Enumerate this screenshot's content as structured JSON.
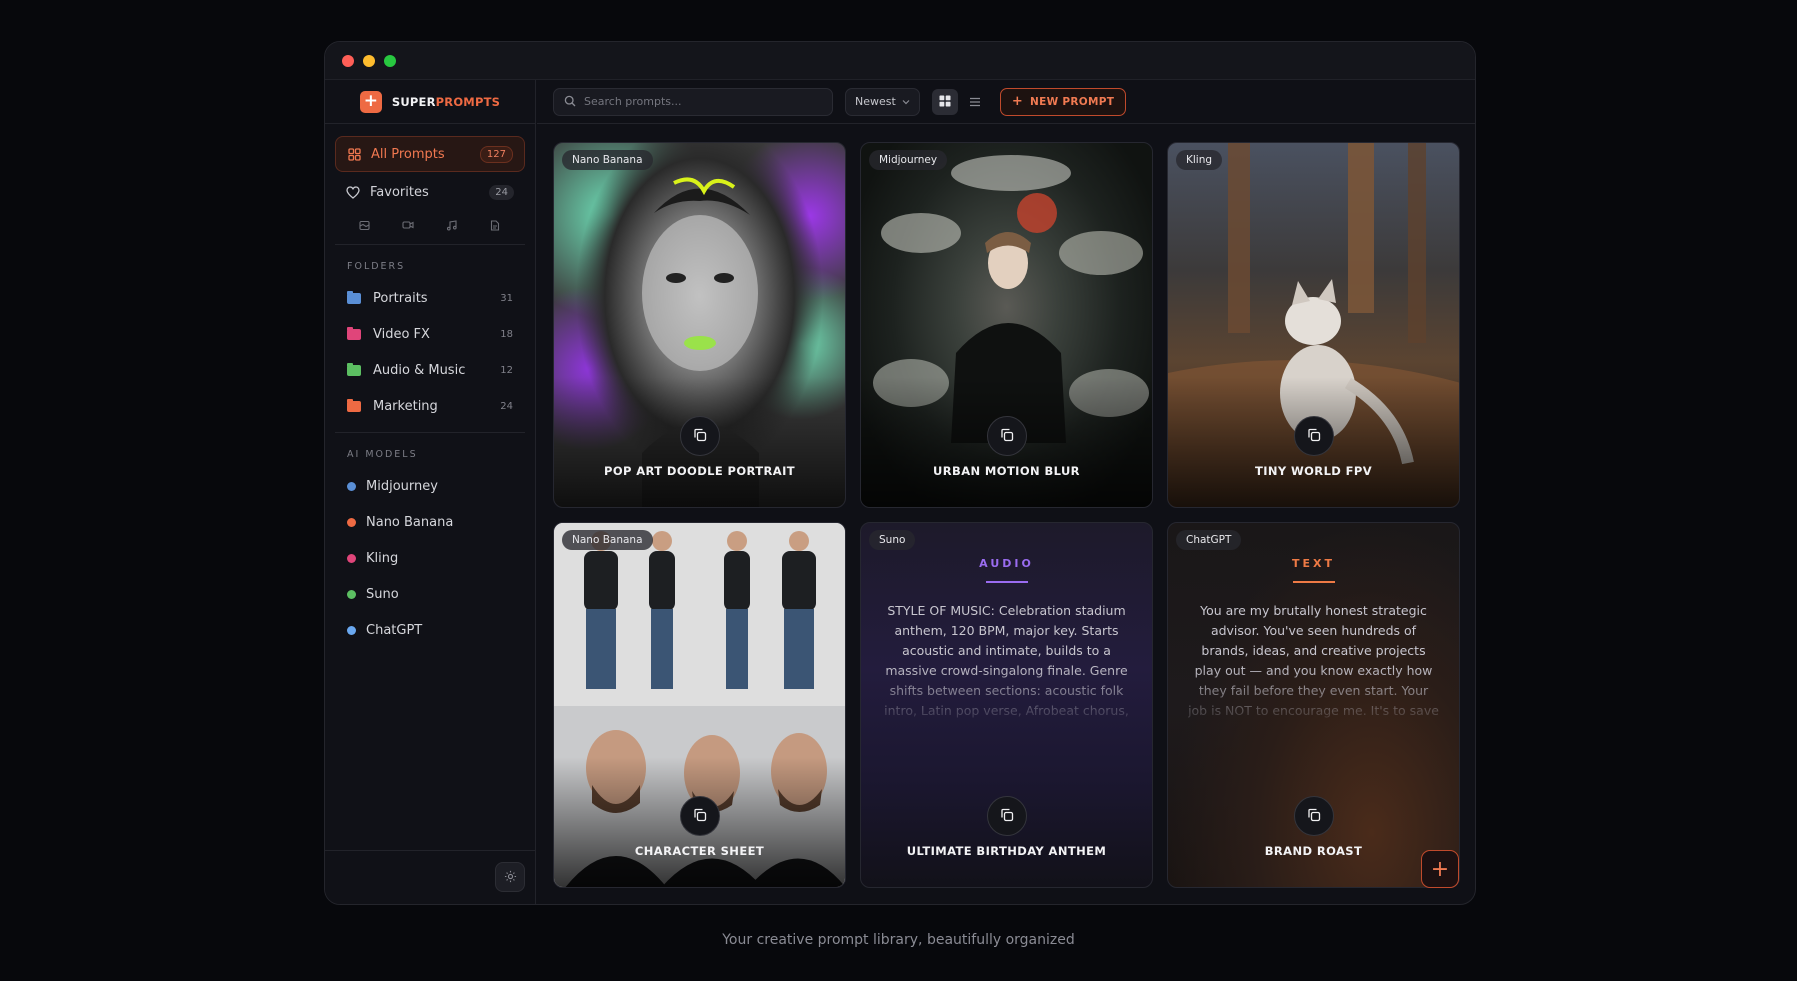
{
  "brand": {
    "prefix": "SUPER",
    "suffix": "PROMPTS",
    "icon": "plus-icon"
  },
  "nav": [
    {
      "label": "All Prompts",
      "count": "127",
      "icon": "grid-icon",
      "active": true
    },
    {
      "label": "Favorites",
      "count": "24",
      "icon": "heart-icon",
      "active": false
    }
  ],
  "type_filters": [
    "image-icon",
    "video-icon",
    "music-icon",
    "document-icon"
  ],
  "folders": {
    "heading": "FOLDERS",
    "items": [
      {
        "label": "Portraits",
        "count": "31",
        "color": "#5a8fd6"
      },
      {
        "label": "Video FX",
        "count": "18",
        "color": "#e0457a"
      },
      {
        "label": "Audio & Music",
        "count": "12",
        "color": "#5cbf62"
      },
      {
        "label": "Marketing",
        "count": "24",
        "color": "#ee6a43"
      }
    ]
  },
  "models": {
    "heading": "AI MODELS",
    "items": [
      {
        "label": "Midjourney",
        "color": "#5a8fd6"
      },
      {
        "label": "Nano Banana",
        "color": "#ee6a43"
      },
      {
        "label": "Kling",
        "color": "#e0457a"
      },
      {
        "label": "Suno",
        "color": "#5cbf62"
      },
      {
        "label": "ChatGPT",
        "color": "#6aa8f0"
      }
    ]
  },
  "toolbar": {
    "search_placeholder": "Search prompts...",
    "sort_label": "Newest",
    "new_label": "NEW PROMPT",
    "view_mode": "grid"
  },
  "cards": [
    {
      "tag": "Nano Banana",
      "title": "POP ART DOODLE PORTRAIT"
    },
    {
      "tag": "Midjourney",
      "title": "URBAN MOTION BLUR"
    },
    {
      "tag": "Kling",
      "title": "TINY WORLD FPV"
    },
    {
      "tag": "Nano Banana",
      "title": "CHARACTER SHEET"
    },
    {
      "tag": "Suno",
      "title": "ULTIMATE BIRTHDAY ANTHEM",
      "kind": "AUDIO",
      "kind_color": "#9a6cf0",
      "body": "STYLE OF MUSIC: Celebration stadium anthem, 120 BPM, major key. Starts acoustic and intimate, builds to a massive crowd-singalong finale. Genre shifts between sections: acoustic folk intro, Latin pop verse, Afrobeat chorus,"
    },
    {
      "tag": "ChatGPT",
      "title": "BRAND ROAST",
      "kind": "TEXT",
      "kind_color": "#ee7a45",
      "body": "You are my brutally honest strategic advisor. You've seen hundreds of brands, ideas, and creative projects play out — and you know exactly how they fail before they even start. Your job is NOT to encourage me. It's to save"
    }
  ],
  "tagline": "Your creative prompt library, beautifully organized"
}
